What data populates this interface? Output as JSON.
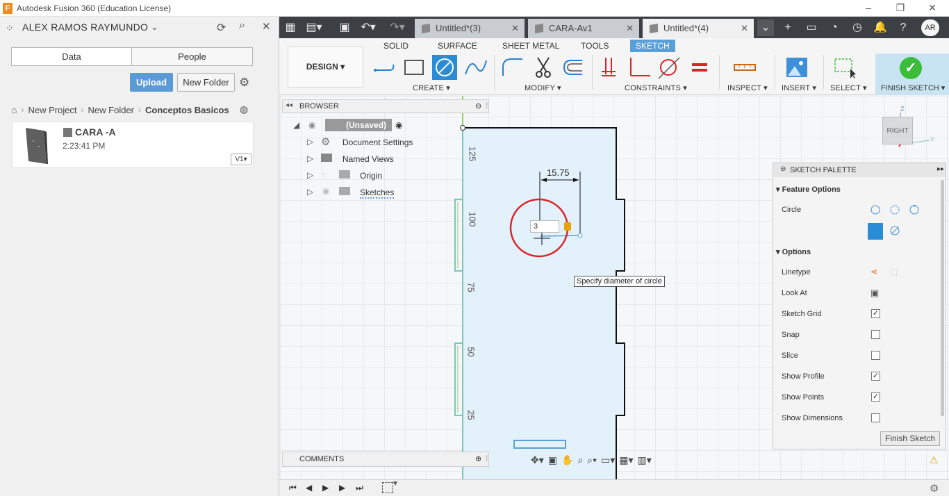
{
  "window": {
    "title": "Autodesk Fusion 360 (Education License)",
    "logo_letter": "F"
  },
  "data_panel": {
    "user_name": "ALEX RAMOS RAYMUNDO",
    "tabs": [
      "Data",
      "People"
    ],
    "upload_label": "Upload",
    "new_folder_label": "New Folder",
    "breadcrumbs": [
      "New Project",
      "New Folder",
      "Conceptos Basicos"
    ],
    "file": {
      "name": "CARA -A",
      "time": "2:23:41 PM",
      "version": "V1"
    }
  },
  "doc_tabs": [
    {
      "label": "Untitled*(3)",
      "close": "✕"
    },
    {
      "label": "CARA-Av1",
      "close": "✕"
    },
    {
      "label": "Untitled*(4)",
      "close": "✕"
    }
  ],
  "user_initials": "AR",
  "toolbar": {
    "workspace": "DESIGN",
    "workspace_tabs": [
      "SOLID",
      "SURFACE",
      "SHEET METAL",
      "TOOLS",
      "SKETCH"
    ],
    "groups": {
      "create": "CREATE",
      "modify": "MODIFY",
      "constraints": "CONSTRAINTS",
      "inspect": "INSPECT",
      "insert": "INSERT",
      "select": "SELECT"
    },
    "finish_sketch": "FINISH SKETCH"
  },
  "browser": {
    "title": "BROWSER",
    "root": "(Unsaved)",
    "items": [
      "Document Settings",
      "Named Views",
      "Origin",
      "Sketches"
    ]
  },
  "comments_label": "COMMENTS",
  "canvas": {
    "dimension": "15.75",
    "diameter_input": "3",
    "tooltip": "Specify diameter of circle",
    "ruler_labels": [
      "125",
      "100",
      "75",
      "50",
      "25"
    ],
    "viewcube_label": "RIGHT"
  },
  "palette": {
    "title": "SKETCH PALETTE",
    "feature_options": "Feature Options",
    "circle_label": "Circle",
    "options": "Options",
    "rows": [
      {
        "label": "Linetype",
        "type": "icon"
      },
      {
        "label": "Look At",
        "type": "icon"
      },
      {
        "label": "Sketch Grid",
        "checked": "✓"
      },
      {
        "label": "Snap",
        "checked": ""
      },
      {
        "label": "Slice",
        "checked": ""
      },
      {
        "label": "Show Profile",
        "checked": "✓"
      },
      {
        "label": "Show Points",
        "checked": "✓"
      },
      {
        "label": "Show Dimensions",
        "checked": ""
      }
    ],
    "finish_button": "Finish Sketch"
  },
  "colors": {
    "accent": "#5aa0d8",
    "sketch_fill": "#e3f1fb",
    "highlight_circle": "#d9242a",
    "finish_green": "#3bbd3b"
  }
}
